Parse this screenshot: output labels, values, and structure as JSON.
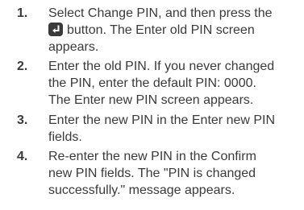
{
  "steps": [
    {
      "number": "1.",
      "lines": [
        "Select Change PIN, and then press the",
        "button. The Enter old PIN screen",
        "appears."
      ],
      "icon": "enter-icon"
    },
    {
      "number": "2.",
      "lines": [
        "Enter the old PIN. If you never changed",
        "the PIN, enter the default PIN: 0000.",
        "The Enter new PIN screen appears."
      ]
    },
    {
      "number": "3.",
      "lines": [
        "Enter the new PIN in the Enter new PIN",
        "fields."
      ]
    },
    {
      "number": "4.",
      "lines": [
        "Re-enter the new PIN in the Confirm",
        "new PIN fields. The \"PIN is changed",
        "successfully.\" message appears."
      ]
    }
  ]
}
